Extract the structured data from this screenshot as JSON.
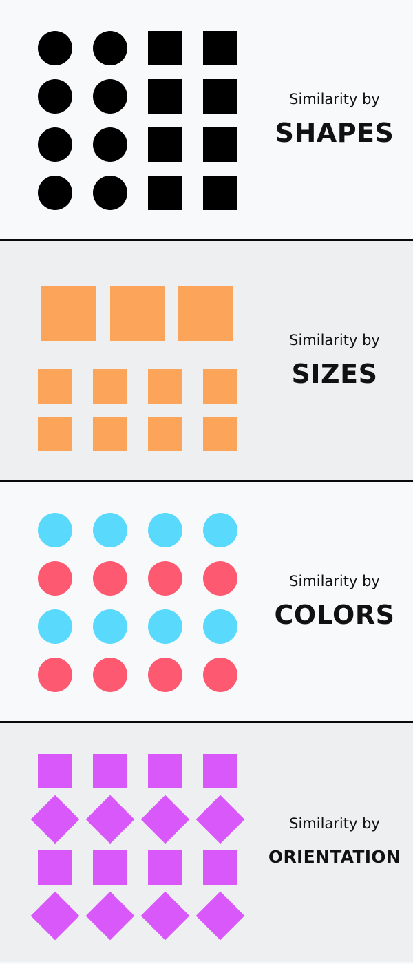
{
  "panels": [
    {
      "id": "shapes",
      "subtitle": "Similarity by",
      "title": "SHAPES",
      "colors": {
        "fill": "#000000"
      }
    },
    {
      "id": "sizes",
      "subtitle": "Similarity by",
      "title": "SIZES",
      "colors": {
        "fill": "#fca55a"
      }
    },
    {
      "id": "colors",
      "subtitle": "Similarity by",
      "title": "COLORS",
      "colors": {
        "row_a": "#59d9fc",
        "row_b": "#fd5a71"
      }
    },
    {
      "id": "orientation",
      "subtitle": "Similarity by",
      "title": "ORIENTATION",
      "colors": {
        "fill": "#d958f9"
      }
    }
  ],
  "colors": {
    "divider": "#0a0a0a",
    "panel_light": "#f8f9fb",
    "panel_gray": "#eeeff1",
    "text": "#111111"
  }
}
